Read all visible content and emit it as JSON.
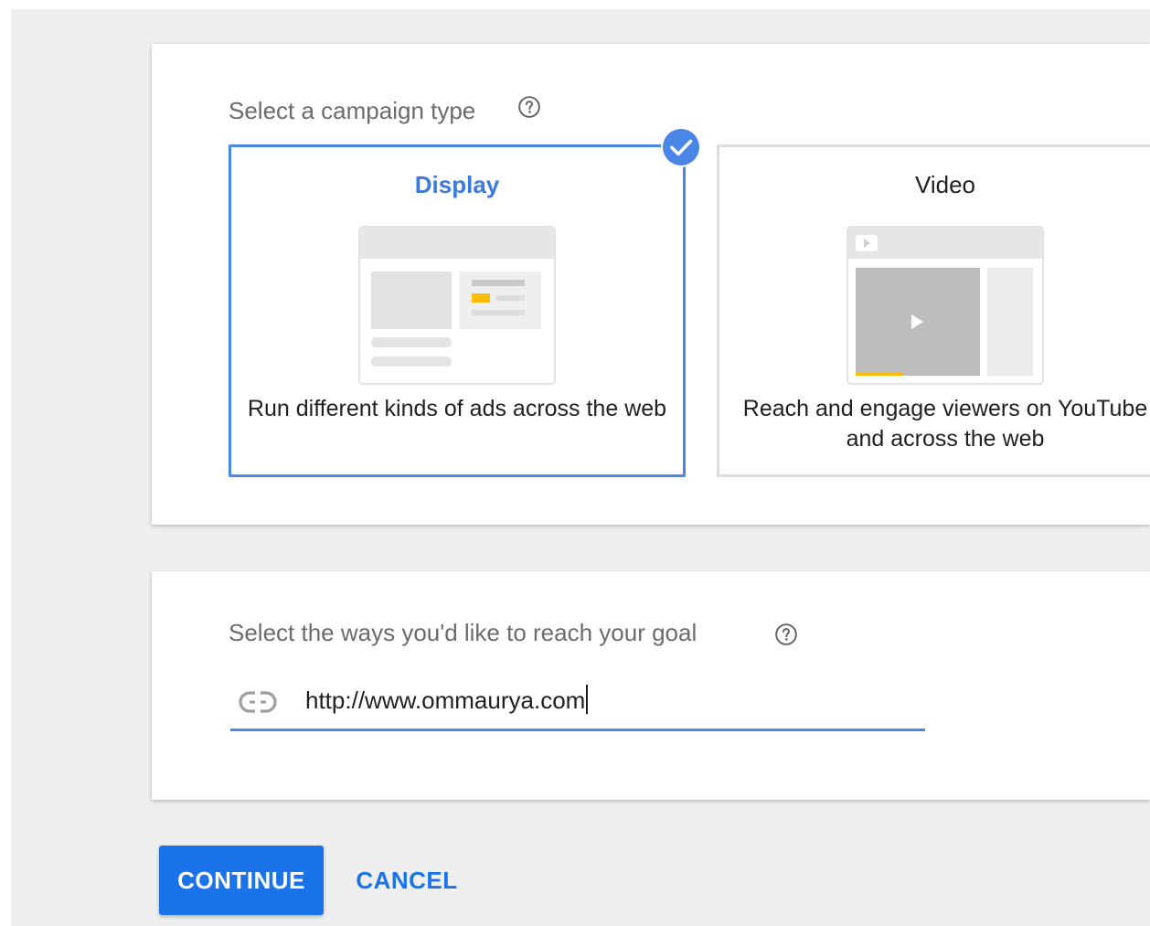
{
  "campaign_type": {
    "title": "Select a campaign type",
    "help_icon": "help-circle-icon",
    "options": [
      {
        "label": "Display",
        "description": "Run different kinds of ads across the web",
        "selected": true,
        "illustration": "display-ad-illustration"
      },
      {
        "label": "Video",
        "description": "Reach and engage viewers on YouTube and across the web",
        "selected": false,
        "illustration": "video-ad-illustration"
      }
    ],
    "selected_icon": "check-circle-icon"
  },
  "goal": {
    "title": "Select the ways you'd like to reach your goal",
    "help_icon": "help-circle-icon",
    "link_icon": "link-icon",
    "url_value": "http://www.ommaurya.com"
  },
  "actions": {
    "continue_label": "CONTINUE",
    "cancel_label": "CANCEL"
  },
  "colors": {
    "accent": "#1a73e8",
    "selected_border": "#4a86e8",
    "display_title": "#3b7ae0",
    "background": "#efefef",
    "card": "#ffffff",
    "yellow_accent": "#fbbc04"
  }
}
